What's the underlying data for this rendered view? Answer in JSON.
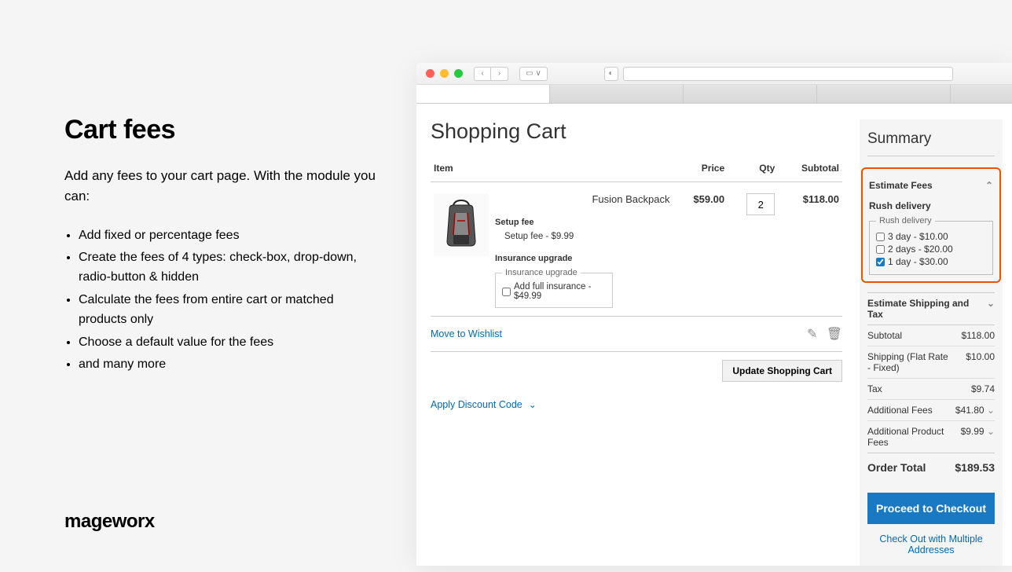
{
  "left": {
    "title": "Cart fees",
    "desc": "Add any fees to your cart page. With the module you can:",
    "bullets": [
      "Add fixed or percentage fees",
      "Create the fees of 4 types: check-box, drop-down, radio-button & hidden",
      "Calculate the fees from entire cart or matched products only",
      "Choose a default value for the fees",
      "and many more"
    ],
    "brand": "mageworx"
  },
  "page": {
    "title": "Shopping Cart",
    "headers": {
      "item": "Item",
      "price": "Price",
      "qty": "Qty",
      "subtotal": "Subtotal"
    },
    "product": {
      "name": "Fusion Backpack",
      "price": "$59.00",
      "qty": "2",
      "subtotal": "$118.00",
      "setup_fee_label": "Setup fee",
      "setup_fee_line": "Setup fee - $9.99",
      "insurance_label": "Insurance upgrade",
      "insurance_legend": "Insurance upgrade",
      "insurance_opt": "Add full insurance - $49.99"
    },
    "move_wishlist": "Move to Wishlist",
    "update_cart": "Update Shopping Cart",
    "apply_discount": "Apply Discount Code"
  },
  "summary": {
    "title": "Summary",
    "estimate_fees": "Estimate Fees",
    "rush_label": "Rush delivery",
    "rush_legend": "Rush delivery",
    "rush_opts": [
      {
        "label": "3 day - $10.00",
        "checked": false
      },
      {
        "label": "2 days - $20.00",
        "checked": false
      },
      {
        "label": "1 day - $30.00",
        "checked": true
      }
    ],
    "estimate_shipping": "Estimate Shipping and Tax",
    "rows": [
      {
        "label": "Subtotal",
        "value": "$118.00"
      },
      {
        "label": "Shipping (Flat Rate - Fixed)",
        "value": "$10.00"
      },
      {
        "label": "Tax",
        "value": "$9.74"
      },
      {
        "label": "Additional Fees",
        "value": "$41.80",
        "caret": true
      },
      {
        "label": "Additional Product Fees",
        "value": "$9.99",
        "caret": true
      }
    ],
    "order_total_label": "Order Total",
    "order_total_value": "$189.53",
    "checkout": "Proceed to Checkout",
    "multi": "Check Out with Multiple Addresses"
  }
}
